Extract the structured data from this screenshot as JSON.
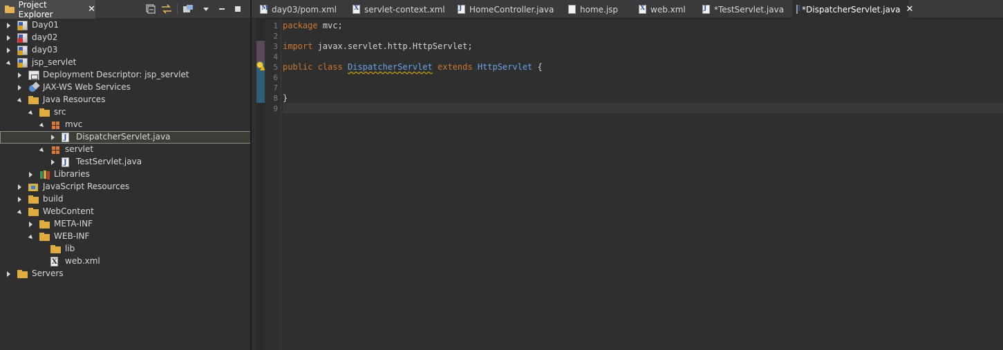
{
  "explorer": {
    "title": "Project Explorer",
    "close": "✕",
    "toolbar": [
      "collapse-all-icon",
      "link-with-editor-icon",
      "focus-icon",
      "view-menu-icon",
      "minimize-icon",
      "maximize-icon"
    ],
    "tree": [
      {
        "label": "Day01",
        "depth": 0,
        "twisty": "closed",
        "icon": "project",
        "badge": "warn"
      },
      {
        "label": "day02",
        "depth": 0,
        "twisty": "closed",
        "icon": "project",
        "badge": "err"
      },
      {
        "label": "day03",
        "depth": 0,
        "twisty": "closed",
        "icon": "project",
        "badge": "warn"
      },
      {
        "label": "jsp_servlet",
        "depth": 0,
        "twisty": "open",
        "icon": "project",
        "badge": "warn"
      },
      {
        "label": "Deployment Descriptor: jsp_servlet",
        "depth": 1,
        "twisty": "closed",
        "icon": "dd"
      },
      {
        "label": "JAX-WS Web Services",
        "depth": 1,
        "twisty": "closed",
        "icon": "ws"
      },
      {
        "label": "Java Resources",
        "depth": 1,
        "twisty": "open",
        "icon": "folder"
      },
      {
        "label": "src",
        "depth": 2,
        "twisty": "open",
        "icon": "folder"
      },
      {
        "label": "mvc",
        "depth": 3,
        "twisty": "open",
        "icon": "package"
      },
      {
        "label": "DispatcherServlet.java",
        "depth": 4,
        "twisty": "closed",
        "icon": "java",
        "selected": true
      },
      {
        "label": "servlet",
        "depth": 3,
        "twisty": "open",
        "icon": "package"
      },
      {
        "label": "TestServlet.java",
        "depth": 4,
        "twisty": "closed",
        "icon": "java"
      },
      {
        "label": "Libraries",
        "depth": 2,
        "twisty": "closed",
        "icon": "books"
      },
      {
        "label": "JavaScript Resources",
        "depth": 1,
        "twisty": "closed",
        "icon": "js"
      },
      {
        "label": "build",
        "depth": 1,
        "twisty": "closed",
        "icon": "folder"
      },
      {
        "label": "WebContent",
        "depth": 1,
        "twisty": "open",
        "icon": "folder"
      },
      {
        "label": "META-INF",
        "depth": 2,
        "twisty": "closed",
        "icon": "folder"
      },
      {
        "label": "WEB-INF",
        "depth": 2,
        "twisty": "open",
        "icon": "folder"
      },
      {
        "label": "lib",
        "depth": 3,
        "twisty": "none",
        "icon": "folder"
      },
      {
        "label": "web.xml",
        "depth": 3,
        "twisty": "none",
        "icon": "xml"
      },
      {
        "label": "Servers",
        "depth": 0,
        "twisty": "closed",
        "icon": "folder"
      }
    ]
  },
  "editor": {
    "tabs": [
      {
        "label": "day03/pom.xml",
        "glyph": "M",
        "active": false
      },
      {
        "label": "servlet-context.xml",
        "glyph": "X",
        "active": false
      },
      {
        "label": "HomeController.java",
        "glyph": "J",
        "active": false
      },
      {
        "label": "home.jsp",
        "glyph": "",
        "active": false
      },
      {
        "label": "web.xml",
        "glyph": "X",
        "active": false
      },
      {
        "label": "*TestServlet.java",
        "glyph": "J",
        "active": false
      },
      {
        "label": "*DispatcherServlet.java",
        "glyph": "J",
        "active": true
      }
    ],
    "tab_close": "✕",
    "line_numbers": [
      "1",
      "2",
      "3",
      "4",
      "5",
      "6",
      "7",
      "8",
      "9"
    ],
    "code": {
      "line1_kw": "package",
      "line1_rest": " mvc;",
      "line3_kw": "import",
      "line3_rest": " javax.servlet.http.HttpServlet;",
      "line5_kw1": "public class",
      "line5_cls": "DispatcherServlet",
      "line5_kw2": "extends",
      "line5_type": "HttpServlet",
      "line5_brace": " {",
      "line8": "}"
    }
  }
}
